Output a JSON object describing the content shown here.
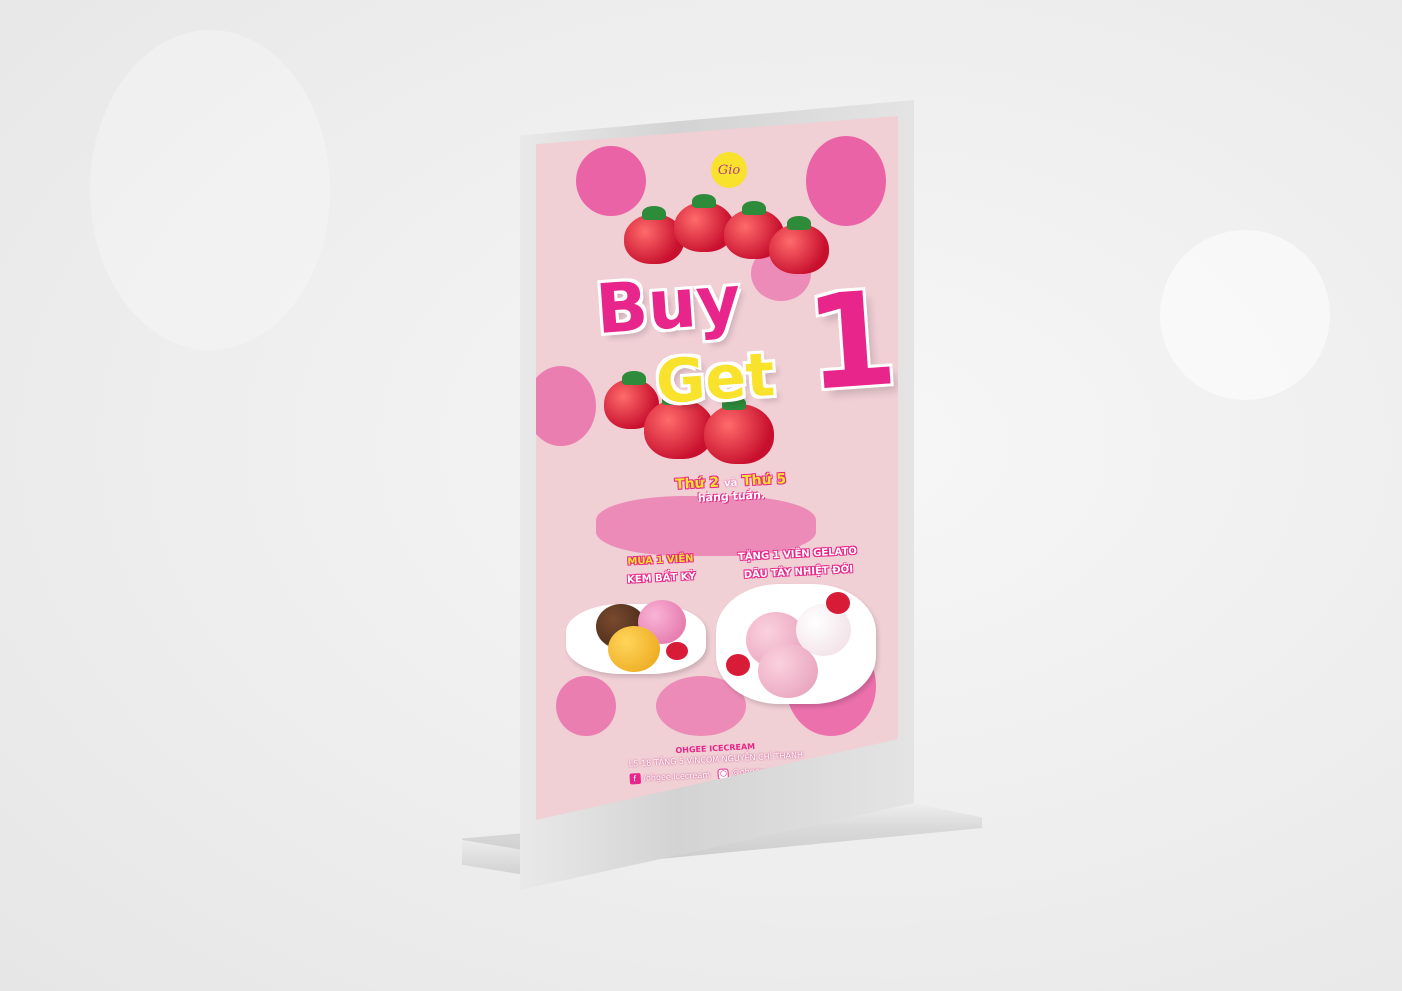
{
  "poster": {
    "logo_text": "Gio",
    "headline": {
      "buy": "Buy",
      "get": "Get",
      "one": "1"
    },
    "days": {
      "day1": "Thứ 2",
      "and": "và",
      "day2": "Thứ 5",
      "weekly": "hàng tuần."
    },
    "offer_left": {
      "line1": "MUA 1 VIÊN",
      "line2": "KEM BẤT KỲ"
    },
    "offer_right": {
      "line1": "TẶNG 1 VIÊN GELATO",
      "line2": "DÂU TÂY NHIỆT ĐỚI"
    },
    "footer": {
      "brand": "OHGEE ICECREAM",
      "address": "L5-18 TẦNG 5 VINCOM NGUYỄN CHÍ THANH",
      "facebook": "/ohgee.icecream",
      "instagram": "@ohgee.icecream"
    }
  },
  "colors": {
    "pink": "#e8258a",
    "yellow": "#f8e22b",
    "poster_background": "#f0cfd5"
  },
  "icons": {
    "facebook": "facebook-icon",
    "instagram": "instagram-icon"
  }
}
